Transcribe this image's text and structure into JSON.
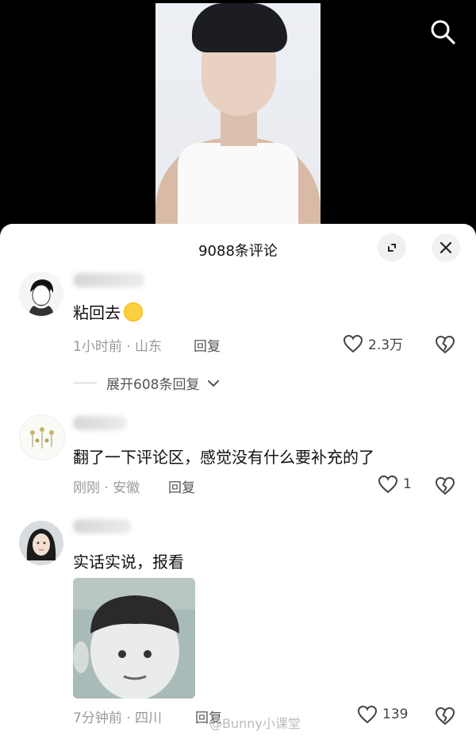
{
  "sheet": {
    "title": "9088条评论"
  },
  "comments": [
    {
      "text": "粘回去",
      "meta": "1小时前 · 山东",
      "reply": "回复",
      "likes": "2.3万",
      "expand": "展开608条回复"
    },
    {
      "text": "翻了一下评论区，感觉没有什么要补充的了",
      "meta": "刚刚 · 安徽",
      "reply": "回复",
      "likes": "1"
    },
    {
      "text": "实话实说，报看",
      "meta": "7分钟前 · 四川",
      "reply": "回复",
      "likes": "139"
    }
  ],
  "watermark": "@Bunny小课堂"
}
